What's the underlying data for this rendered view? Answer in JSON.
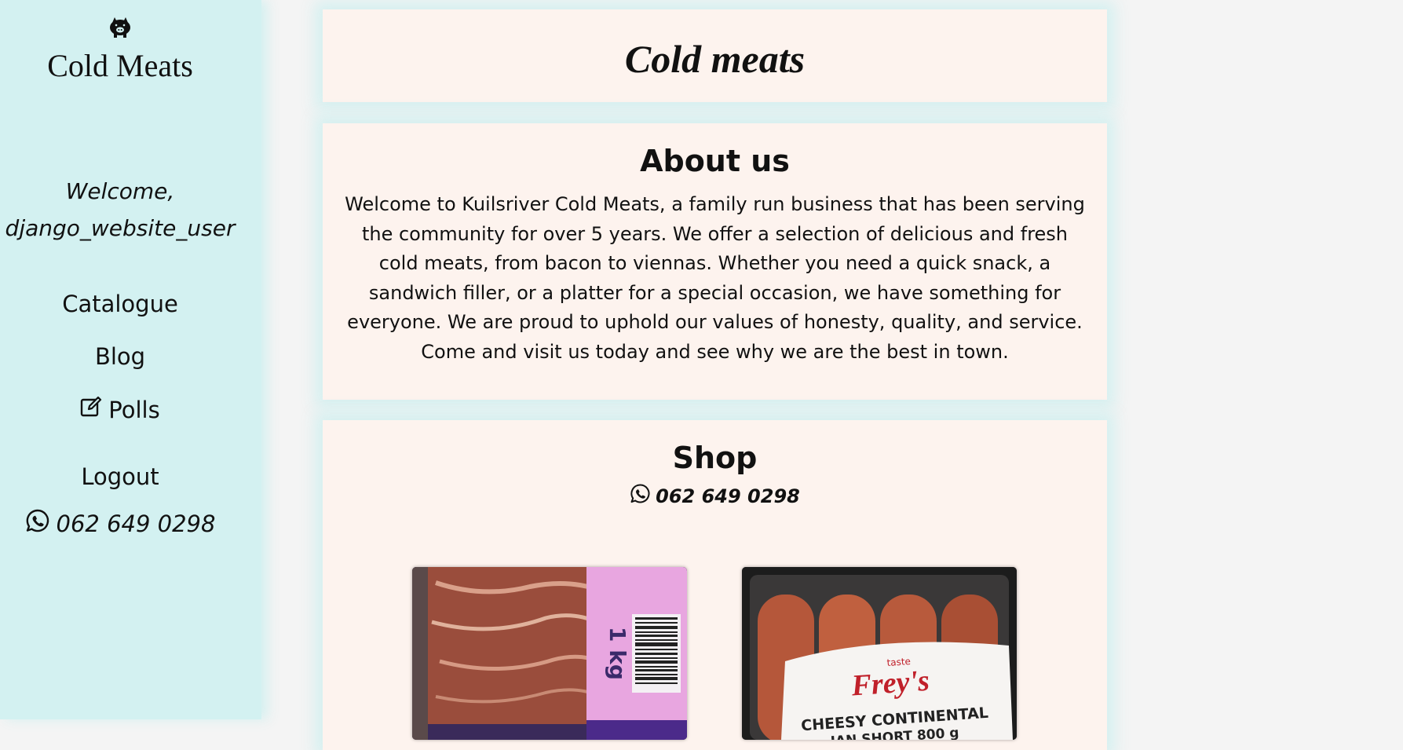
{
  "sidebar": {
    "logo_icon": "pig-icon",
    "brand": "Cold Meats",
    "welcome_line1": "Welcome,",
    "welcome_line2": "django_website_user",
    "nav": {
      "catalogue": "Catalogue",
      "blog": "Blog",
      "polls": "Polls",
      "polls_icon": "edit-icon",
      "logout": "Logout"
    },
    "phone": "062 649 0298",
    "phone_icon": "whatsapp-icon"
  },
  "main": {
    "title": "Cold meats",
    "about": {
      "heading": "About us",
      "text": "Welcome to Kuilsriver Cold Meats, a family run business that has been serving the community for over 5 years. We offer a selection of delicious and fresh cold meats, from bacon to viennas. Whether you need a quick snack, a sandwich filler, or a platter for a special occasion, we have something for everyone. We are proud to uphold our values of honesty, quality, and service. Come and visit us today and see why we are the best in town."
    },
    "shop": {
      "heading": "Shop",
      "phone": "062 649 0298",
      "phone_icon": "whatsapp-icon",
      "products": [
        {
          "label": "1 kg"
        },
        {
          "brand_small": "taste",
          "brand": "Frey's",
          "label_line1": "CHEESY CONTINENTAL",
          "label_line2": "IAN SHORT 800 g"
        }
      ]
    }
  },
  "colors": {
    "sidebar_bg": "#d3f1f1",
    "panel_bg": "#fdf3ee",
    "page_bg": "#f4f4f4",
    "brand_red": "#c0202a"
  }
}
